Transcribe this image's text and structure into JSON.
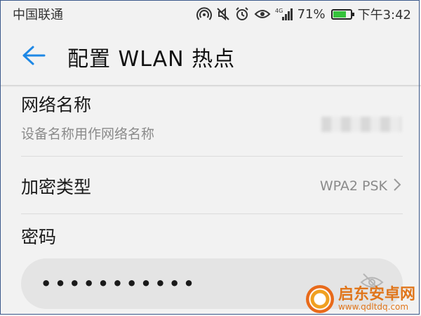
{
  "status_bar": {
    "carrier": "中国联通",
    "network": "4G",
    "battery_percent": "71%",
    "battery_level": 0.71,
    "time": "下午3:42",
    "icons": [
      "hotspot-icon",
      "mute-icon",
      "alarm-icon",
      "eye-comfort-icon",
      "signal-icon",
      "battery-charging-icon"
    ]
  },
  "app_bar": {
    "title": "配置 WLAN 热点",
    "back_icon": "arrow-left-icon",
    "accent": "#1e88e5"
  },
  "ssid_row": {
    "title": "网络名称",
    "subtitle": "设备名称用作网络名称"
  },
  "encryption_row": {
    "title": "加密类型",
    "value": "WPA2 PSK"
  },
  "password": {
    "label": "密码",
    "value": "•••••••••••",
    "toggle_icon": "eye-off-icon"
  },
  "watermark": {
    "name": "启东安卓网",
    "url": "www.qdltdq.com",
    "color": "#e0761c"
  }
}
